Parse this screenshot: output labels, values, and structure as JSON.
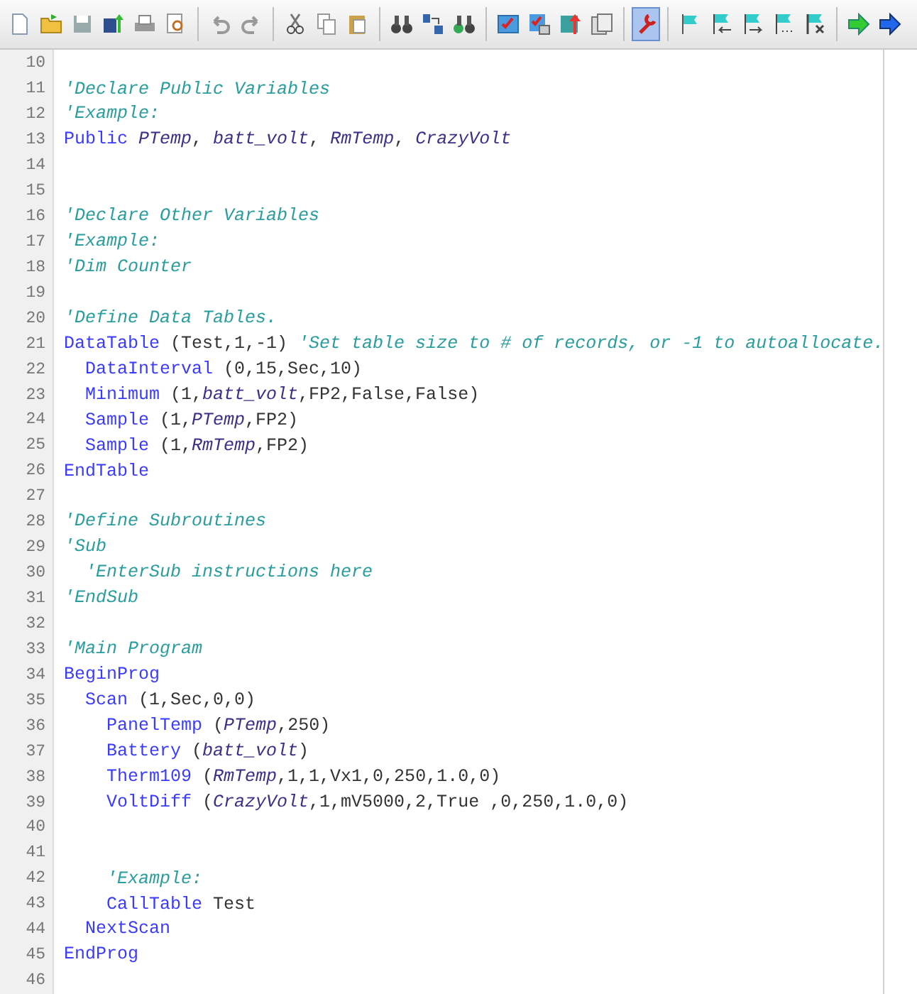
{
  "toolbar": [
    [
      {
        "selected": false
      },
      {
        "selected": false
      },
      {
        "selected": false
      },
      {
        "selected": false
      },
      {
        "selected": false
      },
      {
        "selected": false
      }
    ],
    [
      {
        "selected": false
      },
      {
        "selected": false
      }
    ],
    [
      {
        "selected": false
      },
      {
        "selected": false
      },
      {
        "selected": false
      }
    ],
    [
      {
        "selected": false
      },
      {
        "selected": false
      },
      {
        "selected": false
      }
    ],
    [
      {
        "selected": false
      },
      {
        "selected": false
      },
      {
        "selected": false
      },
      {
        "selected": false
      }
    ],
    [
      {
        "selected": true
      }
    ],
    [
      {
        "selected": false
      },
      {
        "selected": false
      },
      {
        "selected": false
      },
      {
        "selected": false
      },
      {
        "selected": false
      }
    ],
    [
      {
        "selected": false
      },
      {
        "selected": false
      }
    ]
  ],
  "lines": [
    {
      "number": "10"
    },
    {
      "number": "11",
      "tokens": [
        {
          "kind": "comment",
          "text": "'Declare Public Variables"
        }
      ]
    },
    {
      "number": "12",
      "tokens": [
        {
          "kind": "comment",
          "text": "'Example:"
        }
      ]
    },
    {
      "number": "13",
      "tokens": [
        {
          "kind": "keyword",
          "text": "Public "
        },
        {
          "kind": "variable",
          "text": "PTemp"
        },
        {
          "kind": "plain",
          "text": ", "
        },
        {
          "kind": "variable",
          "text": "batt_volt"
        },
        {
          "kind": "plain",
          "text": ", "
        },
        {
          "kind": "variable",
          "text": "RmTemp"
        },
        {
          "kind": "plain",
          "text": ", "
        },
        {
          "kind": "variable",
          "text": "CrazyVolt"
        }
      ]
    },
    {
      "number": "14"
    },
    {
      "number": "15"
    },
    {
      "number": "16",
      "tokens": [
        {
          "kind": "comment",
          "text": "'Declare Other Variables"
        }
      ]
    },
    {
      "number": "17",
      "tokens": [
        {
          "kind": "comment",
          "text": "'Example:"
        }
      ]
    },
    {
      "number": "18",
      "tokens": [
        {
          "kind": "comment",
          "text": "'Dim Counter"
        }
      ]
    },
    {
      "number": "19"
    },
    {
      "number": "20",
      "tokens": [
        {
          "kind": "comment",
          "text": "'Define Data Tables."
        }
      ]
    },
    {
      "number": "21",
      "tokens": [
        {
          "kind": "keyword",
          "text": "DataTable"
        },
        {
          "kind": "plain",
          "text": " (Test,1,-1) "
        },
        {
          "kind": "comment",
          "text": "'Set table size to # of records, or -1 to autoallocate."
        }
      ]
    },
    {
      "number": "22",
      "tokens": [
        {
          "kind": "keyword",
          "text": "  DataInterval"
        },
        {
          "kind": "plain",
          "text": " (0,15,Sec,10)"
        }
      ]
    },
    {
      "number": "23",
      "tokens": [
        {
          "kind": "keyword",
          "text": "  Minimum"
        },
        {
          "kind": "plain",
          "text": " (1,"
        },
        {
          "kind": "variable",
          "text": "batt_volt"
        },
        {
          "kind": "plain",
          "text": ",FP2,False,False)"
        }
      ]
    },
    {
      "number": "24",
      "tokens": [
        {
          "kind": "keyword",
          "text": "  Sample"
        },
        {
          "kind": "plain",
          "text": " (1,"
        },
        {
          "kind": "variable",
          "text": "PTemp"
        },
        {
          "kind": "plain",
          "text": ",FP2)"
        }
      ]
    },
    {
      "number": "25",
      "tokens": [
        {
          "kind": "keyword",
          "text": "  Sample"
        },
        {
          "kind": "plain",
          "text": " (1,"
        },
        {
          "kind": "variable",
          "text": "RmTemp"
        },
        {
          "kind": "plain",
          "text": ",FP2)"
        }
      ]
    },
    {
      "number": "26",
      "tokens": [
        {
          "kind": "keyword",
          "text": "EndTable"
        }
      ]
    },
    {
      "number": "27"
    },
    {
      "number": "28",
      "tokens": [
        {
          "kind": "comment",
          "text": "'Define Subroutines"
        }
      ]
    },
    {
      "number": "29",
      "tokens": [
        {
          "kind": "comment",
          "text": "'Sub"
        }
      ]
    },
    {
      "number": "30",
      "tokens": [
        {
          "kind": "comment",
          "text": "  'EnterSub instructions here"
        }
      ]
    },
    {
      "number": "31",
      "tokens": [
        {
          "kind": "comment",
          "text": "'EndSub"
        }
      ]
    },
    {
      "number": "32"
    },
    {
      "number": "33",
      "tokens": [
        {
          "kind": "comment",
          "text": "'Main Program"
        }
      ]
    },
    {
      "number": "34",
      "tokens": [
        {
          "kind": "keyword",
          "text": "BeginProg"
        }
      ]
    },
    {
      "number": "35",
      "tokens": [
        {
          "kind": "keyword",
          "text": "  Scan"
        },
        {
          "kind": "plain",
          "text": " (1,Sec,0,0)"
        }
      ]
    },
    {
      "number": "36",
      "tokens": [
        {
          "kind": "keyword",
          "text": "    PanelTemp"
        },
        {
          "kind": "plain",
          "text": " ("
        },
        {
          "kind": "variable",
          "text": "PTemp"
        },
        {
          "kind": "plain",
          "text": ",250)"
        }
      ]
    },
    {
      "number": "37",
      "tokens": [
        {
          "kind": "keyword",
          "text": "    Battery"
        },
        {
          "kind": "plain",
          "text": " ("
        },
        {
          "kind": "variable",
          "text": "batt_volt"
        },
        {
          "kind": "plain",
          "text": ")"
        }
      ]
    },
    {
      "number": "38",
      "tokens": [
        {
          "kind": "keyword",
          "text": "    Therm109"
        },
        {
          "kind": "plain",
          "text": " ("
        },
        {
          "kind": "variable",
          "text": "RmTemp"
        },
        {
          "kind": "plain",
          "text": ",1,1,Vx1,0,250,1.0,0)"
        }
      ]
    },
    {
      "number": "39",
      "tokens": [
        {
          "kind": "keyword",
          "text": "    VoltDiff"
        },
        {
          "kind": "plain",
          "text": " ("
        },
        {
          "kind": "variable",
          "text": "CrazyVolt"
        },
        {
          "kind": "plain",
          "text": ",1,mV5000,2,True ,0,250,1.0,0)"
        }
      ]
    },
    {
      "number": "40"
    },
    {
      "number": "41"
    },
    {
      "number": "42",
      "tokens": [
        {
          "kind": "comment",
          "text": "    'Example:"
        }
      ]
    },
    {
      "number": "43",
      "tokens": [
        {
          "kind": "keyword",
          "text": "    CallTable"
        },
        {
          "kind": "plain",
          "text": " Test"
        }
      ]
    },
    {
      "number": "44",
      "tokens": [
        {
          "kind": "keyword",
          "text": "  NextScan"
        }
      ]
    },
    {
      "number": "45",
      "tokens": [
        {
          "kind": "keyword",
          "text": "EndProg"
        }
      ]
    },
    {
      "number": "46"
    }
  ]
}
